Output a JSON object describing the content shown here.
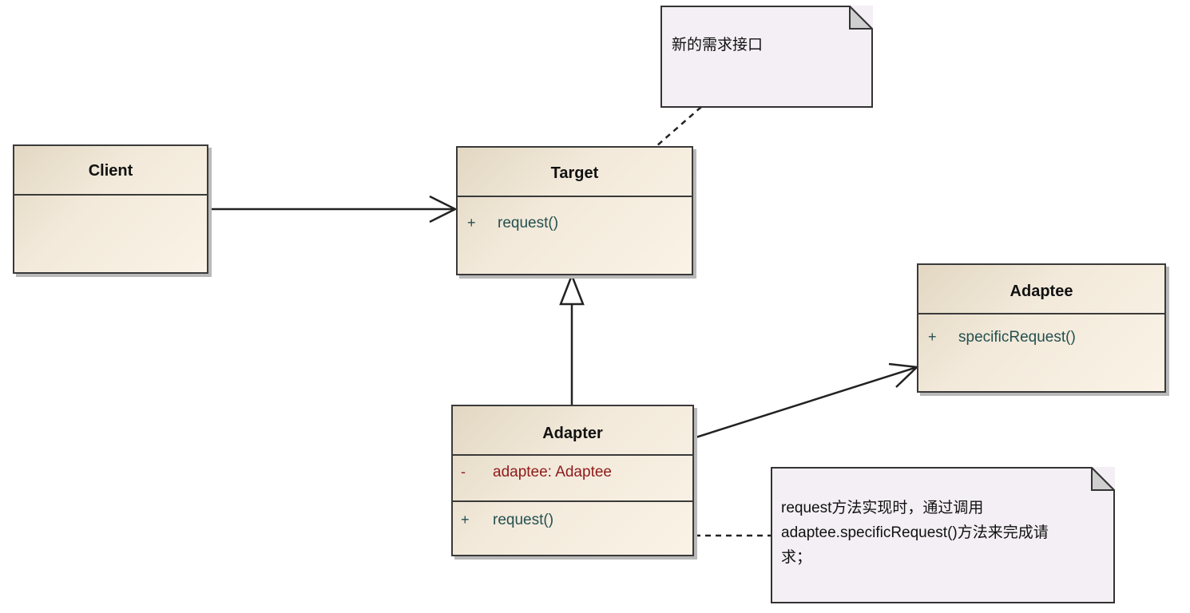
{
  "classes": {
    "client": {
      "name": "Client"
    },
    "target": {
      "name": "Target",
      "operations": [
        {
          "visibility": "+",
          "signature": "request()"
        }
      ]
    },
    "adaptee": {
      "name": "Adaptee",
      "operations": [
        {
          "visibility": "+",
          "signature": "specificRequest()"
        }
      ]
    },
    "adapter": {
      "name": "Adapter",
      "attributes": [
        {
          "visibility": "-",
          "signature": "adaptee:  Adaptee"
        }
      ],
      "operations": [
        {
          "visibility": "+",
          "signature": "request()"
        }
      ]
    }
  },
  "notes": {
    "target_note": {
      "text": "新的需求接口"
    },
    "adapter_note": {
      "lines": [
        "request方法实现时，通过调用",
        "adaptee.specificRequest()方法来完成请",
        "求；"
      ]
    }
  },
  "relationships": [
    {
      "type": "association",
      "from": "Client",
      "to": "Target"
    },
    {
      "type": "generalization",
      "from": "Adapter",
      "to": "Target"
    },
    {
      "type": "association",
      "from": "Adapter",
      "to": "Adaptee"
    },
    {
      "type": "note-anchor",
      "from": "target_note",
      "to": "Target"
    },
    {
      "type": "note-anchor",
      "from": "adapter_note",
      "to": "Adapter"
    }
  ],
  "colors": {
    "class_fill": "#f2e9da",
    "class_border": "#3a3a3a",
    "note_fill": "#f4eff4",
    "operation_text": "#245050",
    "attribute_text": "#8e1a1a"
  }
}
